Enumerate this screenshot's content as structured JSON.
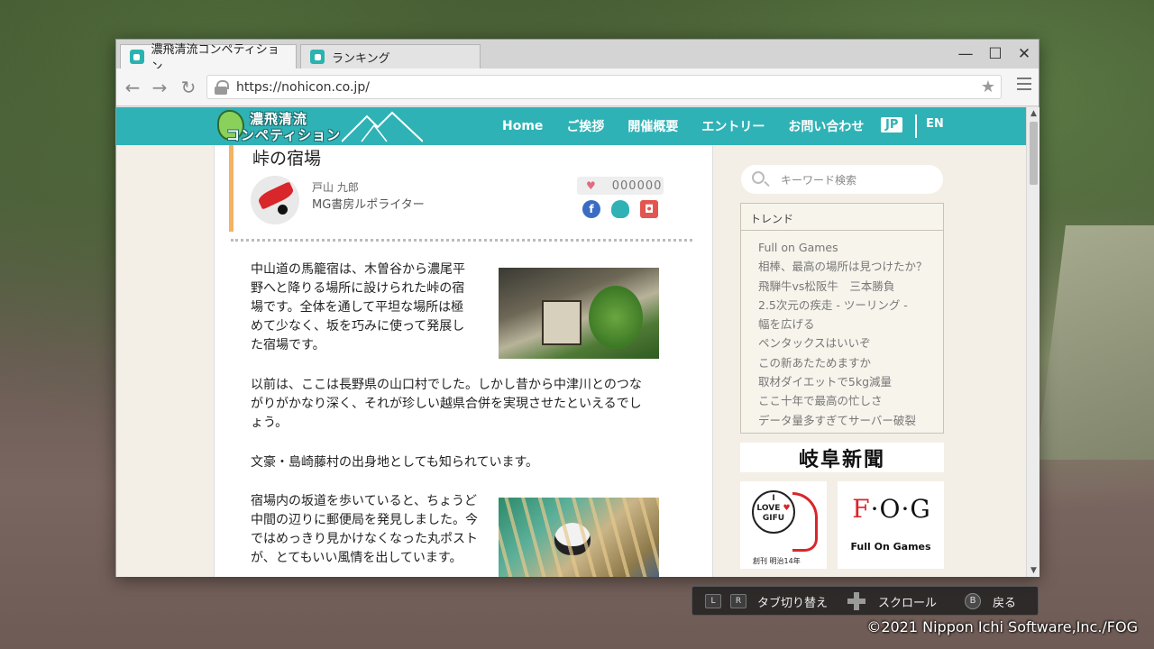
{
  "browser": {
    "tabs": [
      {
        "label": "濃飛清流コンペティション",
        "active": true
      },
      {
        "label": "ランキング",
        "active": false
      }
    ],
    "url": "https://nohicon.co.jp/",
    "window_controls": {
      "minimize": "—",
      "maximize": "☐",
      "close": "✕"
    }
  },
  "site": {
    "logo_line1": "濃飛清流",
    "logo_line2": "コンペティション",
    "nav": [
      "Home",
      "ご挨拶",
      "開催概要",
      "エントリー",
      "お問い合わせ"
    ],
    "lang_jp": "JP",
    "lang_en": "EN",
    "accent_color": "#2fb2b5"
  },
  "article": {
    "title": "峠の宿場",
    "author_name": "戸山 九郎",
    "author_role": "MG書房ルポライター",
    "like_count": "000000",
    "share_fb": "f",
    "paragraphs": [
      "中山道の馬籠宿は、木曽谷から濃尾平野へと降りる場所に設けられた峠の宿場です。全体を通して平坦な場所は極めて少なく、坂を巧みに使って発展した宿場です。",
      "以前は、ここは長野県の山口村でした。しかし昔から中津川とのつながりがかなり深く、それが珍しい越県合併を実現させたといえるでしょう。",
      "文豪・島崎藤村の出身地としても知られています。",
      "宿場内の坂道を歩いていると、ちょうど中間の辺りに郵便局を発見しました。今ではめっきり見かけなくなった丸ポストが、とてもいい風情を出しています。"
    ]
  },
  "sidebar": {
    "search_placeholder": "キーワード検索",
    "trend_heading": "トレンド",
    "trends": [
      "Full on Games",
      "相棒、最高の場所は見つけたか？",
      "飛騨牛vs松阪牛　三本勝負",
      "2.5次元の疾走 - ツーリング -",
      "幅を広げる",
      "ペンタックスはいいぞ",
      "この新あたためますか",
      "取材ダイエットで5kg減量",
      "ここ十年で最高の忙しさ",
      "データ量多すぎてサーバー破裂"
    ],
    "ad_gifu": "岐阜新聞",
    "ad_ilove_line1": "I",
    "ad_ilove_line2": "LOVE",
    "ad_ilove_line3": "GIFU",
    "ad_ilove_sub": "創刊 明治14年",
    "ad_fog_f": "F",
    "ad_fog_rest": "·O·G",
    "ad_fog_sub": "Full On Games"
  },
  "hints": {
    "key_l": "L",
    "key_r": "R",
    "tab_switch": "タブ切り替え",
    "scroll": "スクロール",
    "key_b": "B",
    "back": "戻る"
  },
  "copyright": "©2021 Nippon Ichi Software,Inc./FOG"
}
